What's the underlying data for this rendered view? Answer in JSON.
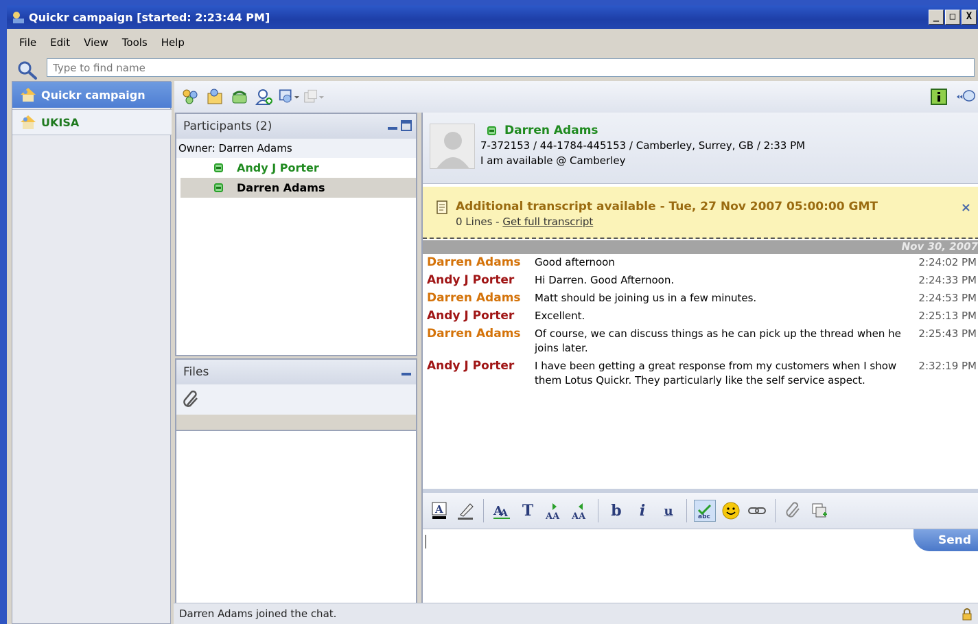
{
  "window": {
    "title": "Quickr campaign [started: 2:23:44 PM]",
    "min": "_",
    "max": "□",
    "close": "X"
  },
  "menu": [
    "File",
    "Edit",
    "View",
    "Tools",
    "Help"
  ],
  "search": {
    "placeholder": "Type to find name"
  },
  "sidebar": {
    "items": [
      {
        "label": "Quickr campaign",
        "active": true
      },
      {
        "label": "UKISA",
        "active": false
      }
    ]
  },
  "participants": {
    "header": "Participants (2)",
    "owner": "Owner: Darren Adams",
    "list": [
      {
        "name": "Andy J Porter",
        "selected": false
      },
      {
        "name": "Darren Adams",
        "selected": true
      }
    ]
  },
  "files": {
    "header": "Files"
  },
  "profile": {
    "name": "Darren Adams",
    "info": "7-372153 / 44-1784-445153 / Camberley, Surrey, GB / 2:33 PM",
    "status": "I am available @ Camberley"
  },
  "transcript": {
    "title": "Additional transcript available - Tue, 27 Nov 2007 05:00:00 GMT",
    "lines": "0 Lines - ",
    "link": "Get full transcript",
    "close": "×"
  },
  "date": "Nov 30, 2007",
  "messages": [
    {
      "from": "Darren Adams",
      "text": "Good afternoon",
      "time": "2:24:02 PM",
      "color": "#d4730a"
    },
    {
      "from": "Andy J Porter",
      "text": "Hi Darren. Good Afternoon.",
      "time": "2:24:33 PM",
      "color": "#a01515"
    },
    {
      "from": "Darren Adams",
      "text": "Matt should be joining us in a few minutes.",
      "time": "2:24:53 PM",
      "color": "#d4730a"
    },
    {
      "from": "Andy J Porter",
      "text": "Excellent.",
      "time": "2:25:13 PM",
      "color": "#a01515"
    },
    {
      "from": "Darren Adams",
      "text": "Of course, we can discuss things as he can pick up the thread when he joins later.",
      "time": "2:25:43 PM",
      "color": "#d4730a"
    },
    {
      "from": "Andy J Porter",
      "text": "I have been getting a great response from my customers when I show them Lotus Quickr. They particularly like the self service aspect.",
      "time": "2:32:19 PM",
      "color": "#a01515"
    }
  ],
  "compose": {
    "send_label": "Send"
  },
  "format": {
    "bold": "b",
    "italic": "i",
    "underline": "u",
    "font_size": "T"
  },
  "status": "Darren Adams joined the chat."
}
